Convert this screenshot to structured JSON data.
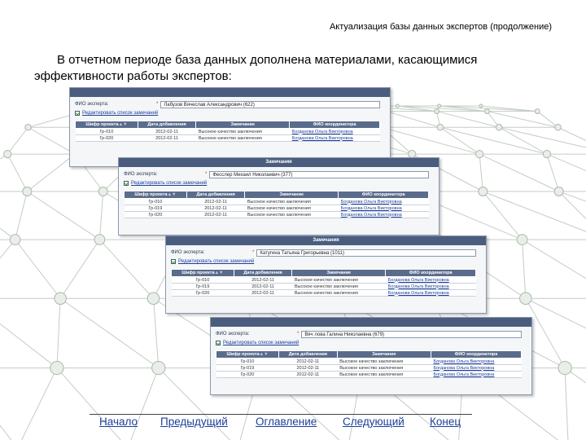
{
  "slide": {
    "title": "Актуализация базы данных экспертов (продолжение)",
    "intro_line1": "В отчетном периоде база данных дополнена материалами, касающимися",
    "intro_line2": "эффективности работы экспертов:"
  },
  "cards": [
    {
      "header": "",
      "field_label": "ФИО эксперта:",
      "field_value": "Лабузов Вячеслав Александрович   (622)",
      "edit_link": "Редактировать список замечаний",
      "columns": [
        "Шифр проекта",
        "Дата добавления",
        "Замечание",
        "ФИО координатора"
      ],
      "rows": [
        [
          "Гр-010",
          "2012-02-11",
          "Высокое качество заключения",
          "Богданова Ольга Викторовна"
        ],
        [
          "Гр-020",
          "2012-02-11",
          "Высокое качество заключения",
          "Богданова Ольга Викторовна"
        ]
      ]
    },
    {
      "header": "Замечания",
      "field_label": "ФИО эксперта:",
      "field_value": "Фесслер Михаил Николаевич (377)",
      "edit_link": "Редактировать список замечаний",
      "columns": [
        "Шифр проекта",
        "Дата добавления",
        "Замечание",
        "ФИО координатора"
      ],
      "rows": [
        [
          "Гр-010",
          "2012-02-11",
          "Высокое качество заключения",
          "Богданова Ольга Викторовна"
        ],
        [
          "Гр-019",
          "2012-02-11",
          "Высокое качество заключения",
          "Богданова Ольга Викторовна"
        ],
        [
          "Гр-020",
          "2012-02-11",
          "Высокое качество заключения",
          "Богданова Ольга Викторовна"
        ]
      ]
    },
    {
      "header": "Замечания",
      "field_label": "ФИО эксперта:",
      "field_value": "Катугина Татьяна Григорьевна (1011)",
      "edit_link": "Редактировать список замечаний",
      "columns": [
        "Шифр проекта",
        "Дата добавления",
        "Замечание",
        "ФИО координатора"
      ],
      "rows": [
        [
          "Гр-010",
          "2012-02-11",
          "Высокое качество заключения",
          "Богданова Ольга Викторовна"
        ],
        [
          "Гр-019",
          "2012-02-11",
          "Высокое качество заключения",
          "Богданова Ольга Викторовна"
        ],
        [
          "Гр-020",
          "2012-02-11",
          "Высокое качество заключения",
          "Богданова Ольга Викторовна"
        ]
      ]
    },
    {
      "header": "",
      "field_label": "ФИО эксперта:",
      "field_value": "Вяч лова Галина Николаевна (679)",
      "edit_link": "Редактировать список замечаний",
      "columns": [
        "Шифр проекта",
        "Дата добавления",
        "Замечание",
        "ФИО координатора"
      ],
      "rows": [
        [
          "Гр-010",
          "2012-02-11",
          "Высокое качество заключения",
          "Богданова Ольга Викторовна"
        ],
        [
          "Гр-019",
          "2012-02-11",
          "Высокое качество заключения",
          "Богданова Ольга Викторовна"
        ],
        [
          "Гр-020",
          "2012-02-11",
          "Высокое качество заключения",
          "Богданова Ольга Викторовна"
        ]
      ]
    }
  ],
  "nav": {
    "start": "Начало",
    "prev": "Предыдущий",
    "contents": "Оглавление",
    "next": "Следующий",
    "end": "Конец"
  },
  "colors": {
    "header_bg": "#4a5d7e",
    "table_header_bg": "#5a6c8c",
    "link": "#1d3f9a",
    "net_line": "#c5ccc5",
    "net_node": "#aab8aa"
  }
}
